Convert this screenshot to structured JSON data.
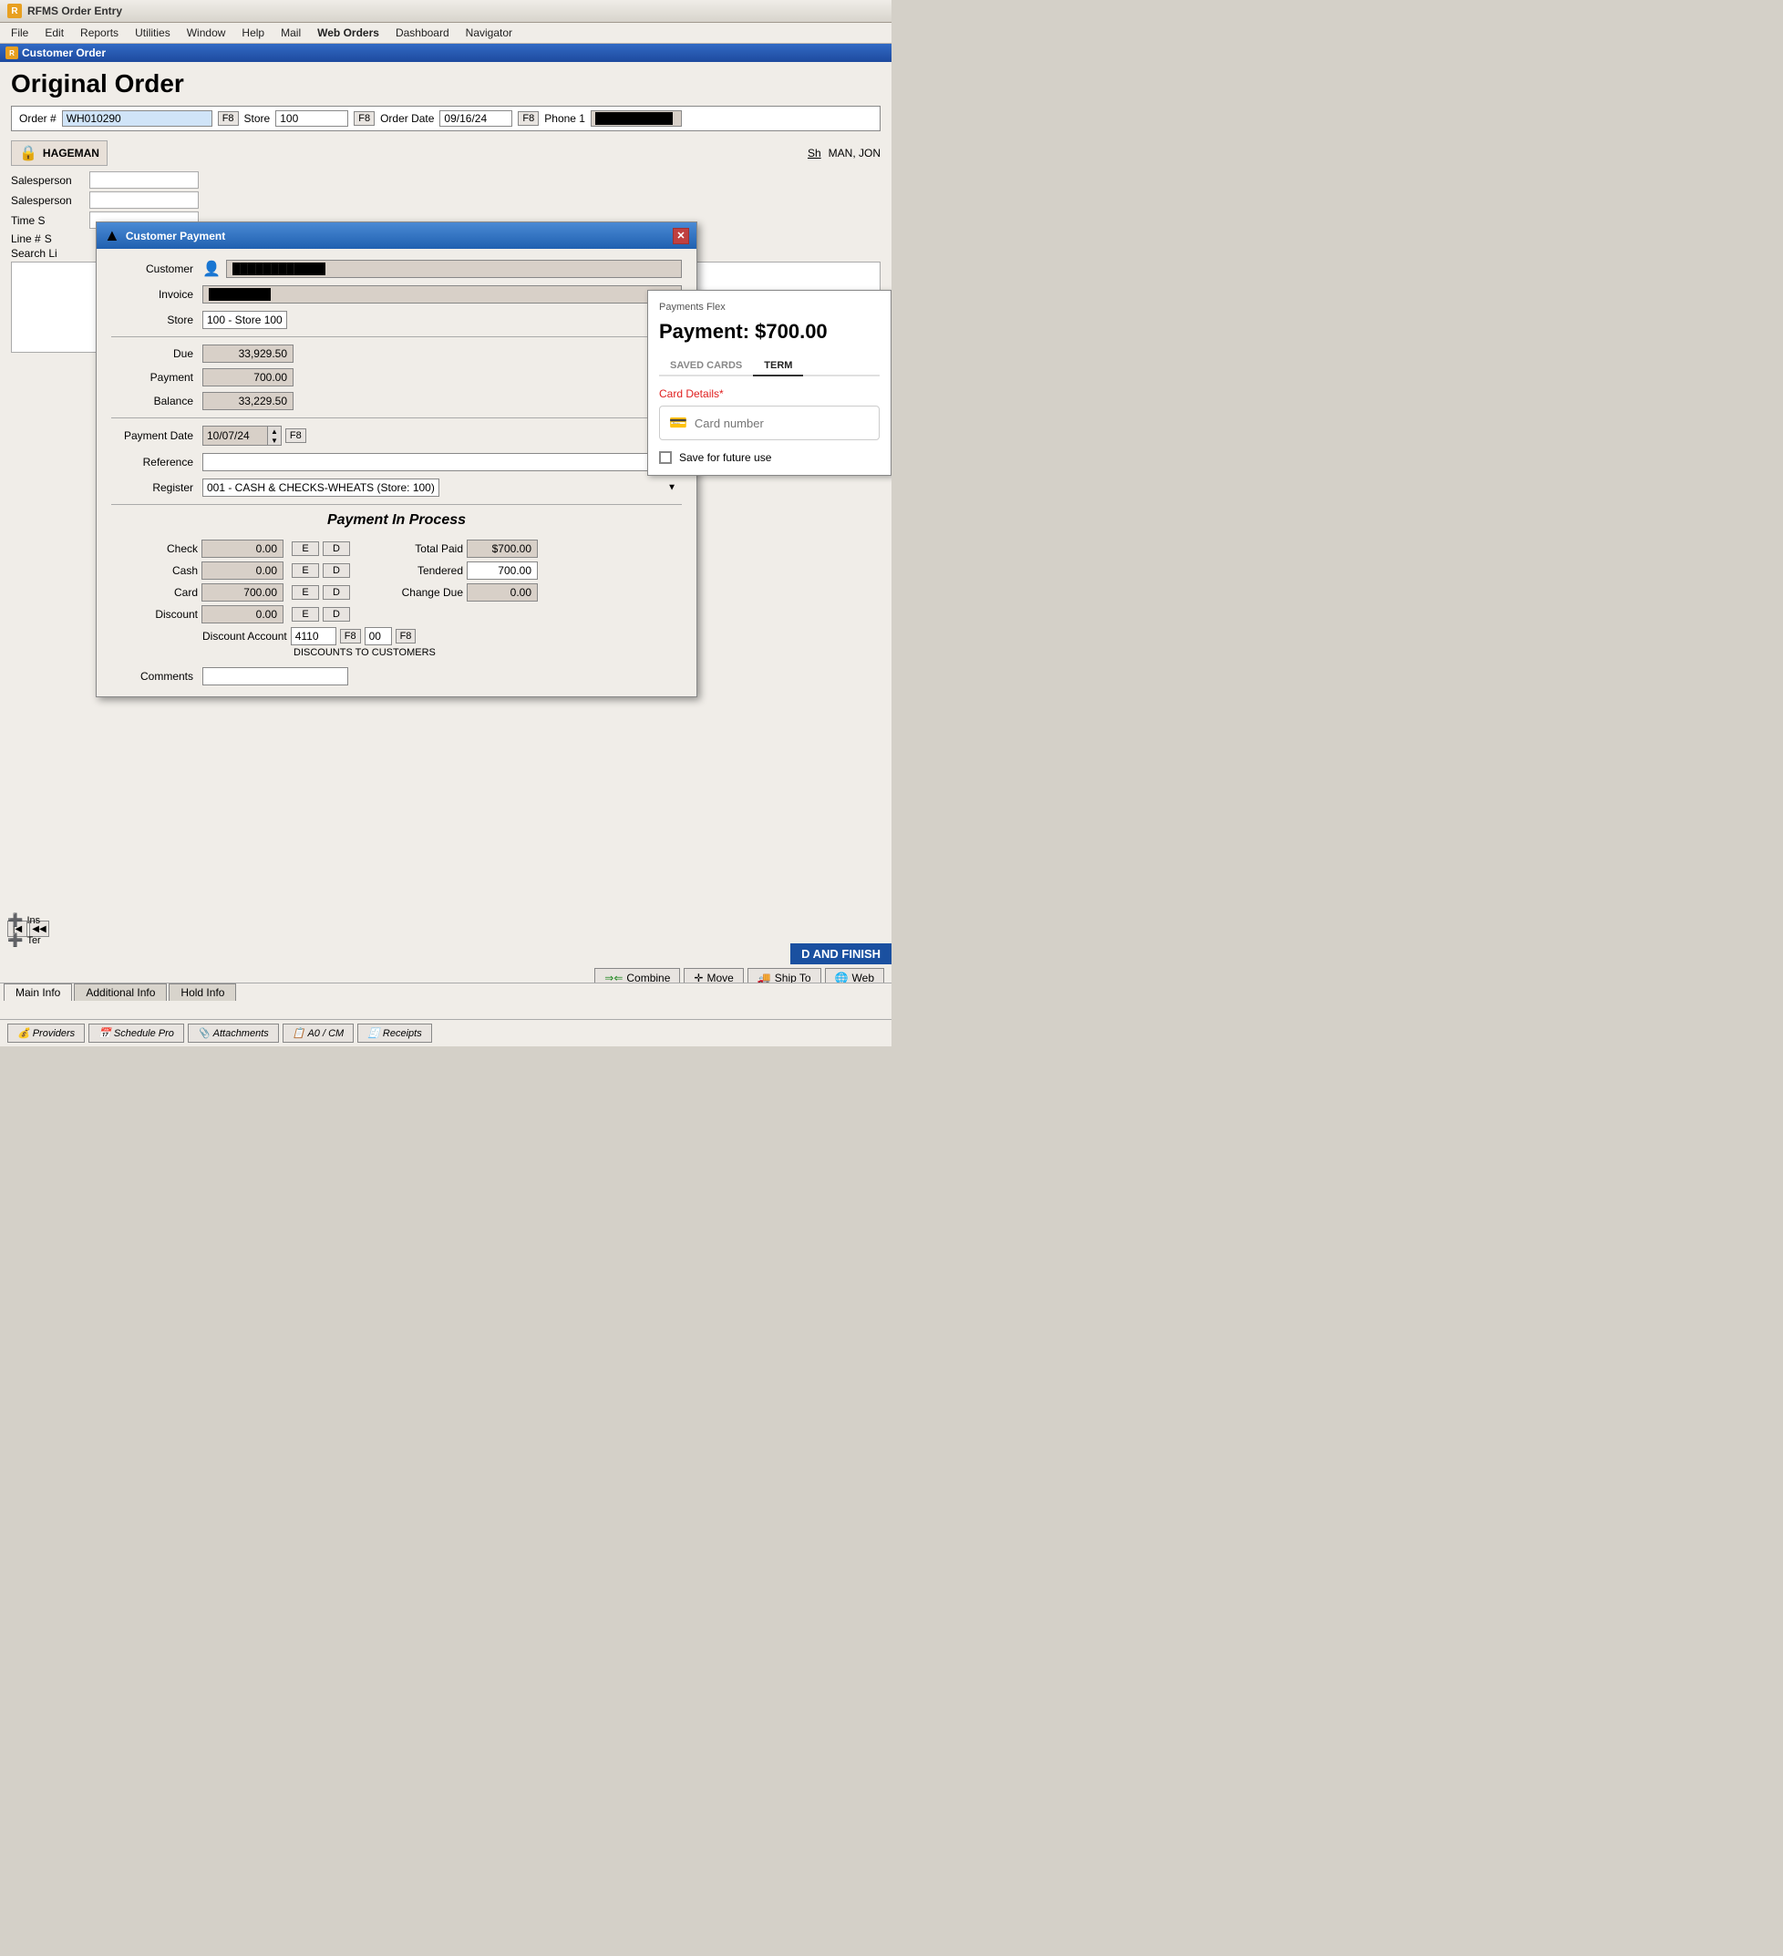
{
  "app": {
    "title": "RFMS Order Entry",
    "icon": "R"
  },
  "menu": {
    "items": [
      "File",
      "Edit",
      "Reports",
      "Utilities",
      "Window",
      "Help",
      "Mail",
      "Web Orders",
      "Dashboard",
      "Navigator"
    ]
  },
  "co_window": {
    "title": "Customer Order"
  },
  "page": {
    "title": "Original Order"
  },
  "order_bar": {
    "order_label": "Order #",
    "order_value": "WH010290",
    "f8_1": "F8",
    "store_label": "Store",
    "store_value": "100",
    "f8_2": "F8",
    "date_label": "Order Date",
    "date_value": "09/16/24",
    "f8_3": "F8",
    "phone_label": "Phone 1",
    "phone_value": "██████████"
  },
  "customer_area": {
    "name": "HAGEMAN",
    "full_name": "MAN, JON",
    "sh_label": "Sh"
  },
  "sales_rows": [
    {
      "label": "Salesperson",
      "value": ""
    },
    {
      "label": "Salesperson",
      "value": ""
    },
    {
      "label": "Time S",
      "value": ""
    }
  ],
  "line_table": {
    "line_label": "Line #",
    "s_label": "S",
    "search_label": "Search Li"
  },
  "payment_dialog": {
    "title": "Customer Payment",
    "customer_label": "Customer",
    "customer_value": "████████████",
    "invoice_label": "Invoice",
    "invoice_value": "████████",
    "store_label": "Store",
    "store_value": "100 - Store 100",
    "due_label": "Due",
    "due_value": "33,929.50",
    "payment_label": "Payment",
    "payment_value": "700.00",
    "balance_label": "Balance",
    "balance_value": "33,229.50",
    "payment_date_label": "Payment Date",
    "payment_date_value": "10/07/24",
    "f8_date": "F8",
    "reference_label": "Reference",
    "reference_value": "",
    "register_label": "Register",
    "register_value": "001 - CASH & CHECKS-WHEATS (Store: 100)",
    "pip_title": "Payment In Process",
    "check_label": "Check",
    "check_value": "0.00",
    "check_e": "E",
    "check_d": "D",
    "cash_label": "Cash",
    "cash_value": "0.00",
    "cash_e": "E",
    "cash_d": "D",
    "card_label": "Card",
    "card_value": "700.00",
    "card_e": "E",
    "card_d": "D",
    "discount_label": "Discount",
    "discount_value": "0.00",
    "discount_e": "E",
    "discount_d": "D",
    "total_paid_label": "Total Paid",
    "total_paid_value": "$700.00",
    "tendered_label": "Tendered",
    "tendered_value": "700.00",
    "change_due_label": "Change Due",
    "change_due_value": "0.00",
    "discount_account_label": "Discount Account",
    "discount_account_value": "4110",
    "discount_account_f8": "F8",
    "discount_account_00": "00",
    "discount_account_f8b": "F8",
    "discount_name": "DISCOUNTS TO CUSTOMERS",
    "comments_label": "Comments",
    "comments_value": ""
  },
  "flex_panel": {
    "title": "Payments Flex",
    "payment_amount": "Payment: $700.00",
    "tab_saved": "SAVED CARDS",
    "tab_term": "TERM",
    "card_details_label": "Card Details",
    "card_details_required": "*",
    "card_number_placeholder": "Card number",
    "save_label": "Save for future use"
  },
  "and_finish": {
    "text": "D AND FINISH"
  },
  "action_buttons": {
    "combine_label": "Combine",
    "combine_icon": "⇒⇐",
    "move_label": "Move",
    "move_icon": "✛",
    "ship_to_label": "Ship To",
    "ship_to_icon": "🚚",
    "web_label": "Web",
    "web_icon": "🌐"
  },
  "tabs": {
    "main_info": "Main Info",
    "additional_info": "Additional Info",
    "hold_info": "Hold Info"
  },
  "bottom_bar": {
    "providers_icon": "💰",
    "providers_label": "Providers",
    "schedule_icon": "📅",
    "schedule_label": "Schedule Pro",
    "attachments_icon": "📎",
    "attachments_label": "Attachments",
    "a0cm_icon": "📋",
    "a0cm_label": "A0 / CM",
    "receipts_icon": "🧾",
    "receipts_label": "Receipts"
  },
  "nav_buttons": {
    "first": "|◀",
    "prev": "◀◀"
  },
  "ins_label": "Ins",
  "ter_label": "Ter"
}
